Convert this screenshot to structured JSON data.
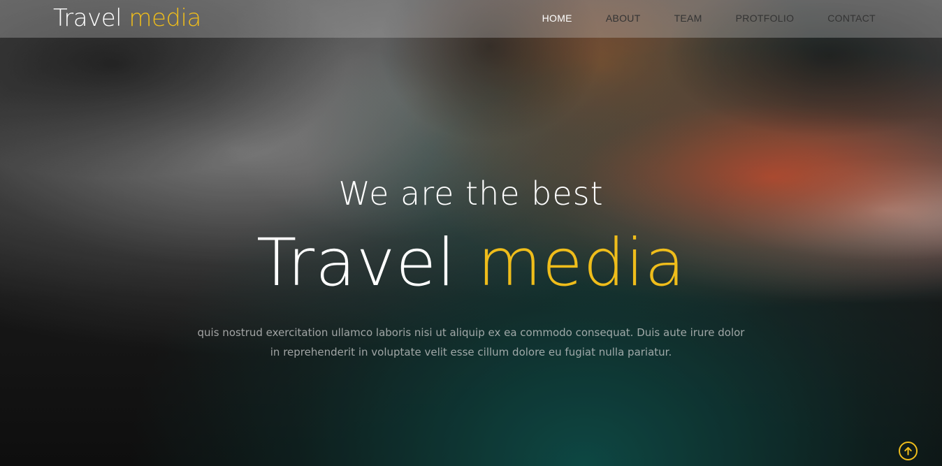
{
  "brand": {
    "name": "Travel",
    "accent": "media"
  },
  "nav": {
    "items": [
      {
        "label": "HOME",
        "active": true
      },
      {
        "label": "ABOUT",
        "active": false
      },
      {
        "label": "TEAM",
        "active": false
      },
      {
        "label": "PROTFOLIO",
        "active": false
      },
      {
        "label": "CONTACT",
        "active": false
      }
    ]
  },
  "hero": {
    "subtitle": "We are the best",
    "title": "Travel",
    "title_accent": "media",
    "description": "quis nostrud exercitation ullamco laboris nisi ut aliquip ex ea commodo consequat. Duis aute irure dolor in reprehenderit in voluptate velit esse cillum dolore eu fugiat nulla pariatur."
  },
  "scroll_top": {
    "icon": "arrow-up-circle-icon"
  },
  "colors": {
    "accent": "#efbd1b",
    "nav_text": "#333333",
    "nav_active": "#ffffff"
  }
}
